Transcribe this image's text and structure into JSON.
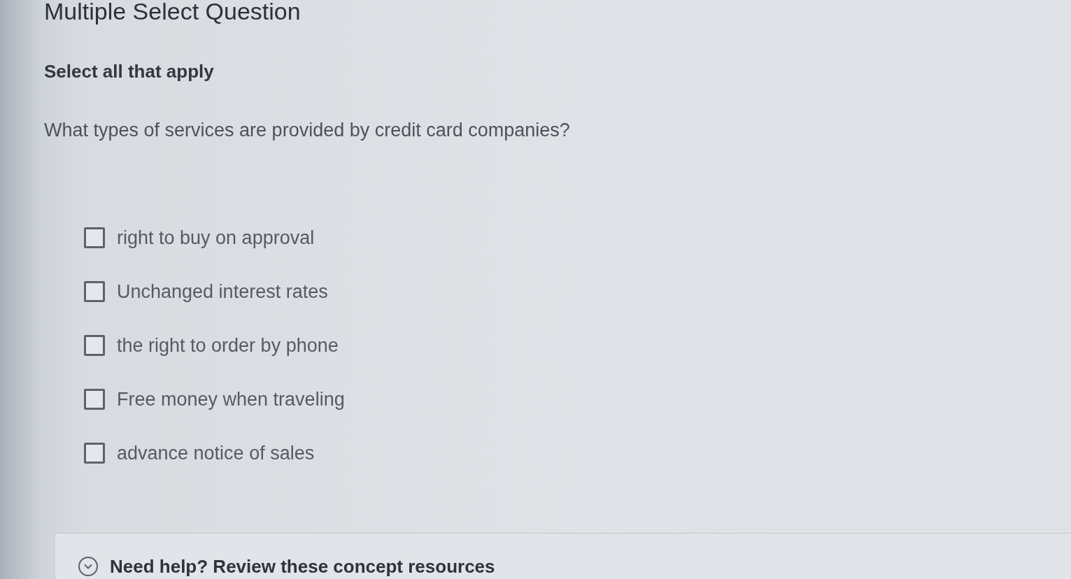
{
  "question": {
    "type": "Multiple Select Question",
    "instruction": "Select all that apply",
    "prompt": "What types of services are provided by credit card companies?"
  },
  "options": [
    {
      "label": "right to buy on approval",
      "checked": false
    },
    {
      "label": "Unchanged interest rates",
      "checked": false
    },
    {
      "label": "the right to order by phone",
      "checked": false
    },
    {
      "label": "Free money when traveling",
      "checked": false
    },
    {
      "label": "advance notice of sales",
      "checked": false
    }
  ],
  "help_panel": {
    "label": "Need help? Review these concept resources",
    "expanded": false
  }
}
